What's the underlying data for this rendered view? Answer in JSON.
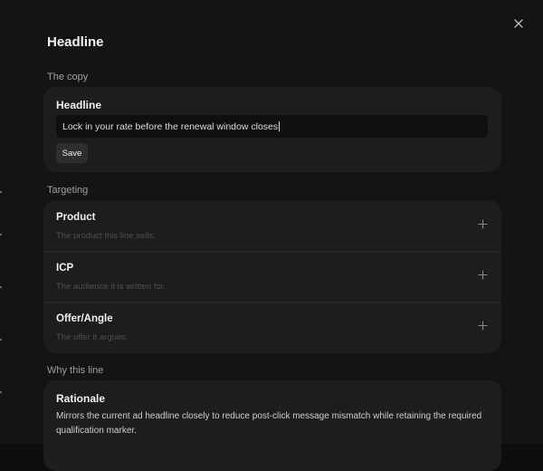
{
  "dialog": {
    "title": "Headline",
    "close_icon": "close-icon"
  },
  "copy_section": {
    "label": "The copy",
    "card_title": "Headline",
    "input_value": "Lock in your rate before the renewal window closes",
    "save_label": "Save"
  },
  "targeting_section": {
    "label": "Targeting",
    "rows": [
      {
        "title": "Product",
        "description": "The product this line sells.",
        "icon": "plus-icon"
      },
      {
        "title": "ICP",
        "description": "The audience it is written for.",
        "icon": "plus-icon"
      },
      {
        "title": "Offer/Angle",
        "description": "The offer it argues.",
        "icon": "plus-icon"
      }
    ]
  },
  "why_section": {
    "label": "Why this line",
    "card_title": "Rationale",
    "text": "Mirrors the current ad headline closely to reduce post-click message mismatch while retaining the required qualification marker."
  }
}
